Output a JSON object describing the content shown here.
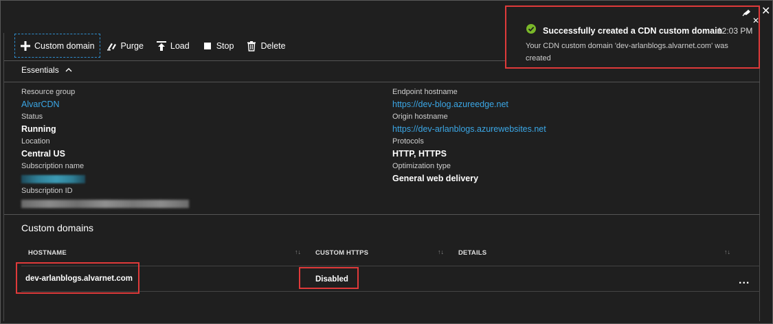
{
  "toolbar": {
    "custom_domain": "Custom domain",
    "purge": "Purge",
    "load": "Load",
    "stop": "Stop",
    "delete": "Delete"
  },
  "essentials": {
    "title": "Essentials",
    "left": [
      {
        "label": "Resource group",
        "value": "AlvarCDN"
      },
      {
        "label": "Status",
        "value": "Running"
      },
      {
        "label": "Location",
        "value": "Central US"
      },
      {
        "label": "Subscription name",
        "value": ""
      },
      {
        "label": "Subscription ID",
        "value": ""
      }
    ],
    "right": [
      {
        "label": "Endpoint hostname",
        "value": "https://dev-blog.azureedge.net"
      },
      {
        "label": "Origin hostname",
        "value": "https://dev-arlanblogs.azurewebsites.net"
      },
      {
        "label": "Protocols",
        "value": "HTTP, HTTPS"
      },
      {
        "label": "Optimization type",
        "value": "General web delivery"
      }
    ]
  },
  "custom_domains": {
    "title": "Custom domains",
    "columns": [
      "HOSTNAME",
      "CUSTOM HTTPS",
      "DETAILS"
    ],
    "rows": [
      {
        "hostname": "dev-arlanblogs.alvarnet.com",
        "custom_https": "Disabled",
        "details": ""
      }
    ],
    "more": "..."
  },
  "notification": {
    "title": "Successfully created a CDN custom domain",
    "time": "12:03 PM",
    "body": "Your CDN custom domain 'dev-arlanblogs.alvarnet.com' was created"
  },
  "colors": {
    "background": "#1f1f1f",
    "link": "#3ba7e6",
    "success": "#7ab829",
    "highlight": "#e03a3a"
  },
  "icons": {
    "custom_domain": "plus-icon",
    "purge": "purge-icon",
    "load": "load-icon",
    "stop": "stop-icon",
    "delete": "trash-icon",
    "success": "check-circle-icon",
    "collapse": "chevron-up-icon",
    "pin": "pin-icon",
    "close": "close-icon"
  }
}
